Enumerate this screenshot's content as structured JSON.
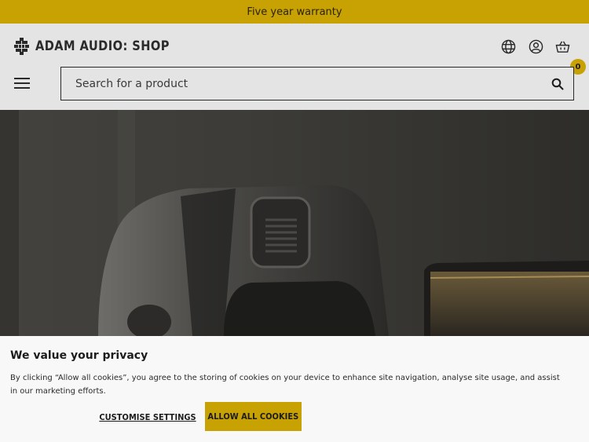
{
  "banner": {
    "text": "Five year warranty"
  },
  "header": {
    "logo_text": "ADAM AUDIO: SHOP",
    "icons": [
      "globe-icon",
      "user-icon",
      "cart-icon"
    ],
    "cart_count": "0",
    "menu_icon": "hamburger-menu-icon"
  },
  "search": {
    "placeholder": "Search for a product",
    "value": "",
    "icon": "search-icon"
  },
  "hero": {
    "subject": "studio-monitor-speaker-photo"
  },
  "cookie": {
    "title": "We value your privacy",
    "text": "By clicking “Allow all cookies”, you agree to the storing of cookies on your device to enhance site navigation, analyse site usage, and assist in our marketing efforts.",
    "customise_label": "CUSTOMISE SETTINGS",
    "allow_label": "ALLOW ALL COOKIES"
  },
  "colors": {
    "accent": "#c8a103",
    "header_bg": "#e4e4e4",
    "text_dark": "#1c1c1c"
  }
}
